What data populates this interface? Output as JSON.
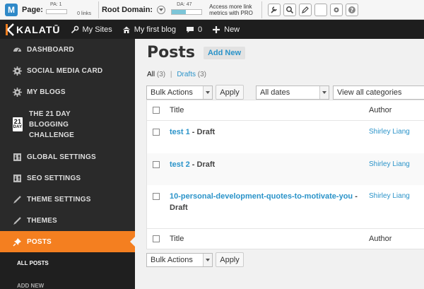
{
  "seo_toolbar": {
    "page_label": "Page:",
    "pa_value": "PA: 1",
    "links_value": "0 links",
    "root_domain_label": "Root Domain:",
    "da_value": "DA: 47",
    "pro_text": "Access more link metrics with PRO",
    "da_fill": 0.47
  },
  "admin_bar": {
    "logo": "KALATŪ",
    "my_sites": "My Sites",
    "site_name": "My first blog",
    "comments_count": "0",
    "new_label": "New"
  },
  "sidebar": {
    "items": [
      {
        "label": "DASHBOARD",
        "icon": "dashboard-icon"
      },
      {
        "label": "SOCIAL MEDIA CARD",
        "icon": "gear-icon"
      },
      {
        "label": "MY BLOGS",
        "icon": "gear-icon"
      },
      {
        "label_lines": [
          "THE 21 DAY",
          "BLOGGING",
          "CHALLENGE"
        ],
        "icon_top": "21",
        "icon_bottom": "DAY"
      },
      {
        "label": "GLOBAL SETTINGS",
        "icon": "settings-grid-icon"
      },
      {
        "label": "SEO SETTINGS",
        "icon": "settings-grid-icon"
      },
      {
        "label": "THEME SETTINGS",
        "icon": "brush-icon"
      },
      {
        "label": "THEMES",
        "icon": "brush-icon"
      },
      {
        "label": "POSTS",
        "icon": "pin-icon",
        "active": true
      }
    ],
    "submenu": [
      {
        "label": "ALL POSTS"
      },
      {
        "label": "ADD NEW"
      }
    ]
  },
  "main": {
    "title": "Posts",
    "add_new": "Add New",
    "filters": {
      "all_label": "All",
      "all_count": "(3)",
      "separator": "|",
      "drafts_label": "Drafts",
      "drafts_count": "(3)"
    },
    "bulk_actions": "Bulk Actions",
    "apply": "Apply",
    "dates": "All dates",
    "categories": "View all categories",
    "columns": {
      "title": "Title",
      "author": "Author"
    },
    "posts": [
      {
        "title": "test 1",
        "state": "Draft",
        "author": "Shirley Liang"
      },
      {
        "title": "test 2",
        "state": "Draft",
        "author": "Shirley Liang"
      },
      {
        "title": "10-personal-development-quotes-to-motivate-you",
        "state": "Draft",
        "author": "Shirley Liang"
      }
    ],
    "state_separator": " - "
  },
  "colors": {
    "accent": "#f47f20",
    "link": "#2a93c9",
    "sidebar": "#2a2a2a",
    "adminbar": "#1e1e1e"
  }
}
